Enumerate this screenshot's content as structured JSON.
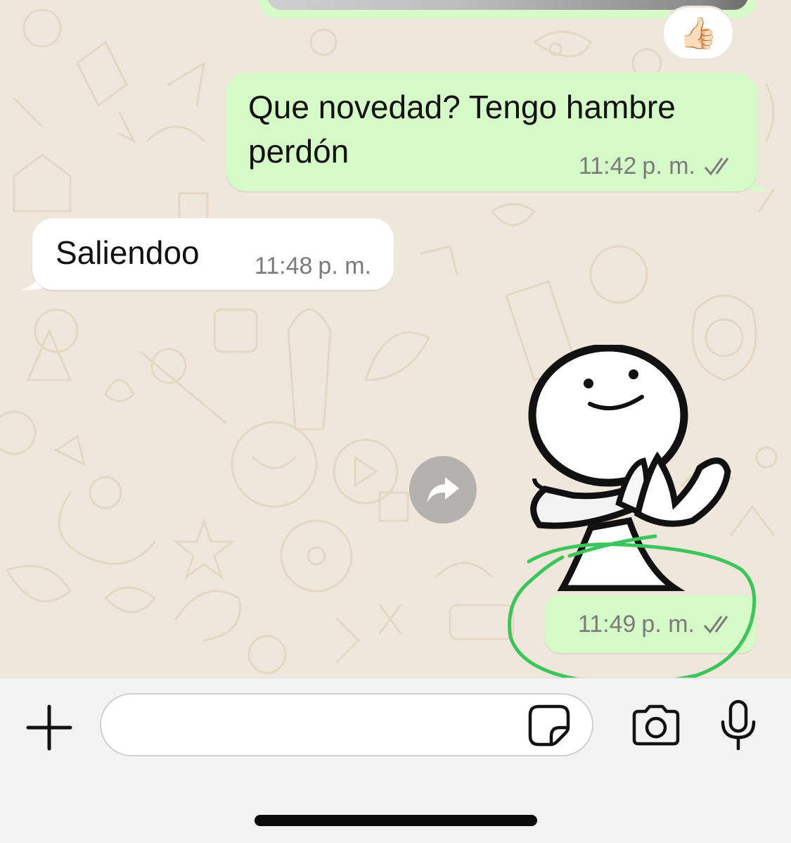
{
  "chat": {
    "reaction_emoji": "👍🏻",
    "messages": [
      {
        "direction": "outgoing",
        "text_line1": "Que novedad? Tengo hambre",
        "text_line2": "perdón",
        "time": "11:42",
        "ampm": "p. m.",
        "status": "read"
      },
      {
        "direction": "incoming",
        "text": "Saliendoo",
        "time": "11:48",
        "ampm": "p. m."
      },
      {
        "direction": "outgoing",
        "type": "sticker",
        "time": "11:49",
        "ampm": "p. m.",
        "status": "read"
      }
    ]
  },
  "input": {
    "placeholder": "",
    "icons": [
      "plus-icon",
      "sticker-icon",
      "camera-icon",
      "microphone-icon"
    ]
  },
  "colors": {
    "outgoing_bubble": "#d6f9c8",
    "incoming_bubble": "#ffffff",
    "wallpaper": "#efe7dc",
    "annotation_circle": "#3cc55a",
    "read_ticks": "#7b7b7b"
  }
}
